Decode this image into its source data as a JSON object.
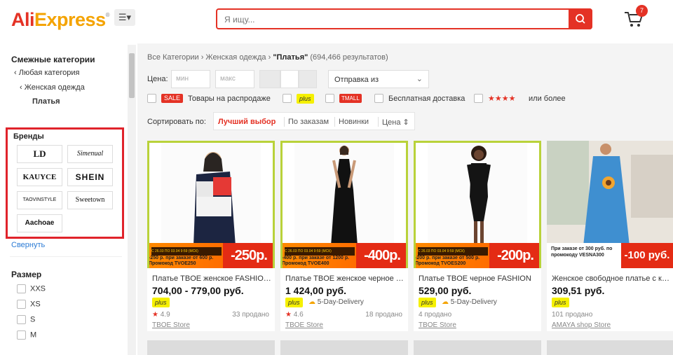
{
  "header": {
    "logo_part1": "Ali",
    "logo_part2": "Express",
    "logo_tm": "®",
    "menu_icon": "hamburger-dropdown-icon",
    "search_placeholder": "Я ищу...",
    "search_icon": "search-icon",
    "cart_icon": "cart-icon",
    "cart_count": "7",
    "accent_color": "#e43225"
  },
  "sidebar": {
    "related_title": "Смежные категории",
    "links": [
      "Любая категория",
      "Женская одежда",
      "Платья"
    ],
    "brands_title": "Бренды",
    "brands": [
      "LD",
      "Simenual",
      "KAUYCE",
      "SHEIN",
      "TAOVINSTYLE",
      "Sweetown",
      "Aachoae"
    ],
    "collapse_label": "Свернуть",
    "size_title": "Размер",
    "sizes": [
      "XXS",
      "XS",
      "S",
      "M"
    ]
  },
  "main": {
    "breadcrumb": {
      "root": "Все Категории",
      "sep": "›",
      "category": "Женская одежда",
      "query": "\"Платья\"",
      "count": "(694,466 результатов)"
    },
    "price": {
      "label": "Цена:",
      "min_placeholder": "мин",
      "max_placeholder": "макс"
    },
    "ship_from": "Отправка из",
    "filters": {
      "sale_badge": "SALE",
      "sale_label": "Товары на распродаже",
      "plus_badge": "plus",
      "tmall_badge": "TMALL",
      "free_shipping": "Бесплатная доставка",
      "stars": "★★★★",
      "or_more": "или более"
    },
    "sort": {
      "label": "Сортировать по:",
      "options": [
        "Лучший выбор",
        "По заказам",
        "Новинки",
        "Цена ⇕"
      ]
    }
  },
  "products": [
    {
      "title": "Платье TBOE женское FASHION т...",
      "price": "704,00 - 779,00 руб.",
      "plus": "plus",
      "delivery": "",
      "rating": "4.9",
      "sold": "33 продано",
      "store": "TBOE Store",
      "promo_code": "-250 р. при заказе от 600 р. Промокод TVOE250",
      "promo_dates": "С 26.03 ПО 03.04 9:59 (МСК)",
      "promo_price": "-250р."
    },
    {
      "title": "Платье TBOE женское черное FA...",
      "price": "1 424,00 руб.",
      "plus": "plus",
      "delivery": "5-Day-Delivery",
      "rating": "4.6",
      "sold": "18 продано",
      "store": "TBOE Store",
      "promo_code": "-400 р. при заказе от 1200 р. Промокод TVOE400",
      "promo_dates": "С 26.03 ПО 03.04 9:59 (МСК)",
      "promo_price": "-400р."
    },
    {
      "title": "Платье TBOE черное FASHION",
      "price": "529,00 руб.",
      "plus": "plus",
      "delivery": "5-Day-Delivery",
      "rating": "",
      "sold": "4 продано",
      "store": "TBOE Store",
      "promo_code": "-200 р. при заказе от 500 р. Промокод TVOES200",
      "promo_dates": "С 26.03 ПО 03.04 9:59 (МСК)",
      "promo_price": "-200р."
    },
    {
      "title": "Женское свободное платье с кор...",
      "price": "309,51 руб.",
      "plus": "plus",
      "delivery": "",
      "rating": "",
      "sold": "101 продано",
      "store": "AMAYA shop Store",
      "promo_code": "При заказе от 300 руб. по промокоду VESNA300",
      "promo_dates": "",
      "promo_price": "-100 руб."
    }
  ]
}
